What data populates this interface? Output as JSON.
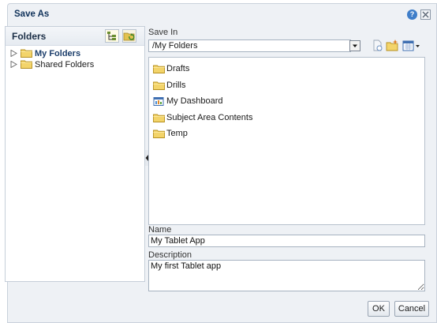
{
  "dialog": {
    "title": "Save As",
    "help_icon": "help-icon",
    "close_icon": "close-icon"
  },
  "folders_panel": {
    "title": "Folders",
    "toolbar_icons": [
      "show-tree-icon",
      "refresh-folders-icon"
    ],
    "tree": [
      {
        "label": "My Folders",
        "bold": true,
        "icon": "folder-icon"
      },
      {
        "label": "Shared Folders",
        "bold": false,
        "icon": "folder-icon"
      }
    ]
  },
  "save_in": {
    "label": "Save In",
    "path": "/My Folders",
    "toolbar_icons": [
      "new-document-icon",
      "new-folder-icon",
      "view-options-icon"
    ],
    "items": [
      {
        "label": "Drafts",
        "icon": "folder-icon"
      },
      {
        "label": "Drills",
        "icon": "folder-icon"
      },
      {
        "label": "My Dashboard",
        "icon": "dashboard-icon"
      },
      {
        "label": "Subject Area Contents",
        "icon": "folder-icon"
      },
      {
        "label": "Temp",
        "icon": "folder-icon"
      }
    ]
  },
  "form": {
    "name_label": "Name",
    "name_value": "My Tablet App",
    "description_label": "Description",
    "description_value": "My first Tablet app"
  },
  "buttons": {
    "ok": "OK",
    "cancel": "Cancel"
  },
  "colors": {
    "dialog_bg": "#eef1f5",
    "title_text": "#10325a",
    "folder_yellow": "#f3d46a",
    "help_blue": "#3f7ec9"
  }
}
